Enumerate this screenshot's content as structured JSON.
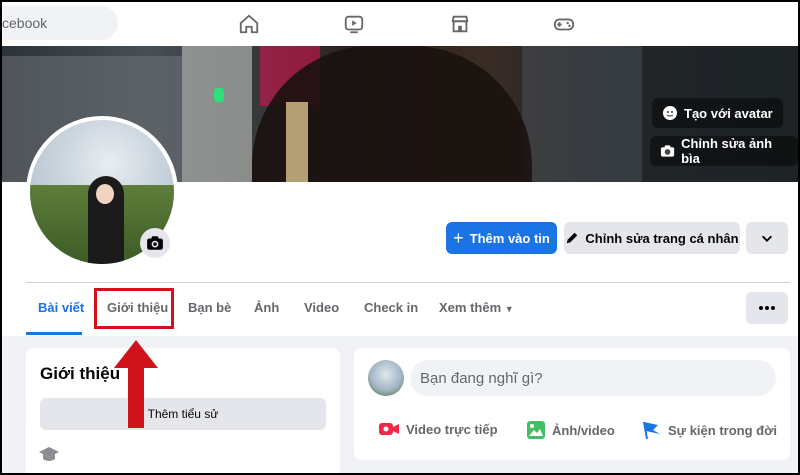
{
  "topbar": {
    "search_placeholder": "cebook",
    "icons": [
      "home-icon",
      "watch-icon",
      "marketplace-icon",
      "gaming-icon"
    ]
  },
  "cover": {
    "create_avatar_label": "Tạo với avatar",
    "edit_cover_label": "Chỉnh sửa ảnh bìa"
  },
  "profile": {
    "add_story_label": "Thêm vào tin",
    "edit_profile_label": "Chỉnh sửa trang cá nhân",
    "dropdown_icon": "chevron-down-icon"
  },
  "tabs": {
    "items": [
      {
        "label": "Bài viết",
        "active": true
      },
      {
        "label": "Giới thiệu",
        "active": false
      },
      {
        "label": "Bạn bè",
        "active": false
      },
      {
        "label": "Ảnh",
        "active": false
      },
      {
        "label": "Video",
        "active": false
      },
      {
        "label": "Check in",
        "active": false
      },
      {
        "label": "Xem thêm",
        "active": false
      }
    ],
    "more_icon": "ellipsis-icon"
  },
  "intro": {
    "title": "Giới thiệu",
    "add_bio_label": "Thêm tiểu sử"
  },
  "composer": {
    "placeholder": "Bạn đang nghĩ gì?",
    "actions": [
      {
        "label": "Video trực tiếp",
        "icon": "live-video-icon",
        "color": "#f02849"
      },
      {
        "label": "Ảnh/video",
        "icon": "photo-icon",
        "color": "#45bd62"
      },
      {
        "label": "Sự kiện trong đời",
        "icon": "flag-icon",
        "color": "#1b74e4"
      }
    ]
  },
  "colors": {
    "accent": "#1b74e4",
    "highlight": "#d0121b"
  }
}
